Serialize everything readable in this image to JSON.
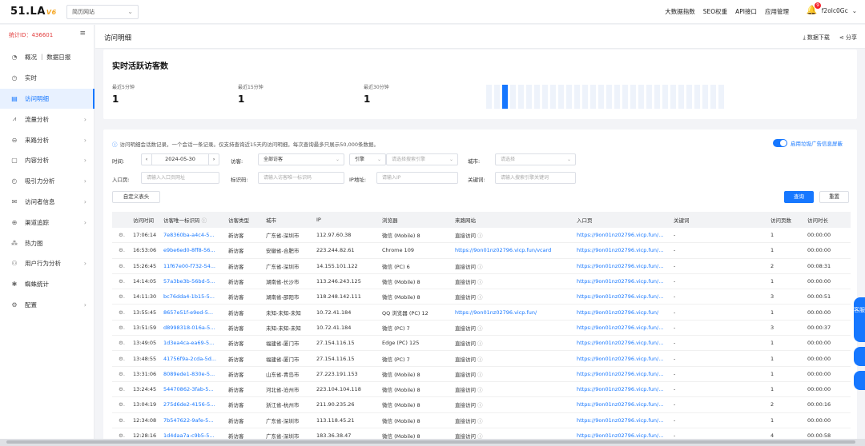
{
  "topbar": {
    "logo": "51.LA",
    "logo_version": "V6",
    "site": "简历网站",
    "nav": [
      "大数据指数",
      "SEO权重",
      "API接口",
      "应用管理"
    ],
    "notification_count": "9",
    "username": "f2olc0Gc"
  },
  "sidebar": {
    "stat_id": "统计ID：436601",
    "items": [
      {
        "label": "概况 ｜ 数据日报",
        "icon": "dashboard-icon",
        "arrow": false,
        "active": false
      },
      {
        "label": "实时",
        "icon": "clock-icon",
        "arrow": false,
        "active": false
      },
      {
        "label": "访问明细",
        "icon": "list-icon",
        "arrow": false,
        "active": true
      },
      {
        "label": "流量分析",
        "icon": "chart-icon",
        "arrow": true,
        "active": false
      },
      {
        "label": "来路分析",
        "icon": "source-icon",
        "arrow": true,
        "active": false
      },
      {
        "label": "内容分析",
        "icon": "file-icon",
        "arrow": true,
        "active": false
      },
      {
        "label": "吸引力分析",
        "icon": "timer-icon",
        "arrow": true,
        "active": false
      },
      {
        "label": "访问者信息",
        "icon": "mail-icon",
        "arrow": true,
        "active": false
      },
      {
        "label": "渠道追踪",
        "icon": "target-icon",
        "arrow": true,
        "active": false
      },
      {
        "label": "热力图",
        "icon": "heatmap-icon",
        "arrow": false,
        "active": false
      },
      {
        "label": "用户行为分析",
        "icon": "users-icon",
        "arrow": true,
        "active": false
      },
      {
        "label": "蜘蛛统计",
        "icon": "spider-icon",
        "arrow": false,
        "active": false
      },
      {
        "label": "配置",
        "icon": "gear-icon",
        "arrow": true,
        "active": false
      }
    ]
  },
  "page": {
    "title": "访问明细",
    "download": "数据下载",
    "share": "分享"
  },
  "realtime": {
    "title": "实时活跃访客数",
    "stats": [
      {
        "label": "最近5分钟",
        "value": "1"
      },
      {
        "label": "最近15分钟",
        "value": "1"
      },
      {
        "label": "最近30分钟",
        "value": "1"
      }
    ],
    "bars_total": 30,
    "bars_active_index": 2
  },
  "filters": {
    "note": "访问明细会话数记录，一个会话一条记录。仅支持查询近15天的访问明细，每次查询最多只展示50,000条数据。",
    "toggle_label": "启用垃圾广告信息屏蔽",
    "time_label": "时间:",
    "date": "2024-05-30",
    "visitor_label": "访客:",
    "visitor_value": "全部访客",
    "engine_label": "引擎",
    "engine_placeholder": "请选择搜索引擎",
    "city_label": "城市:",
    "city_placeholder": "请选择",
    "entry_label": "入口页:",
    "entry_placeholder": "请输入入口页网址",
    "vid_label": "标识码:",
    "vid_placeholder": "请输入访客唯一标识码",
    "ip_label": "IP地址:",
    "ip_placeholder": "请输入IP",
    "kw_label": "关键词:",
    "kw_placeholder": "请输入搜索引擎关键词",
    "custom_header": "自定义表头",
    "query": "查询",
    "reset": "重置"
  },
  "table": {
    "headers": [
      "访问时间",
      "访客唯一标识码",
      "访客类型",
      "城市",
      "IP",
      "浏览器",
      "来路网站",
      "入口页",
      "关键词",
      "访问页数",
      "访问时长"
    ],
    "rows": [
      {
        "time": "17:06:14",
        "vid": "7e8360ba-a4c4-5...",
        "type": "新访客",
        "city": "广东省-深圳市",
        "ip": "112.97.60.38",
        "browser": "微信 (Mobile) 8",
        "source": "直接访问",
        "source_link": false,
        "entry": "https://9on01nz02796.vicp.fun/...",
        "kw": "-",
        "pages": "1",
        "dur": "00:00:00"
      },
      {
        "time": "16:53:06",
        "vid": "e9be6ed0-8ff8-56...",
        "type": "新访客",
        "city": "安徽省-合肥市",
        "ip": "223.244.82.61",
        "browser": "Chrome 109",
        "source": "https://9on01nz02796.vicp.fun/vcard",
        "source_link": true,
        "entry": "https://9on01nz02796.vicp.fun/...",
        "kw": "-",
        "pages": "1",
        "dur": "00:00:00"
      },
      {
        "time": "15:26:45",
        "vid": "11f67e00-f732-54...",
        "type": "新访客",
        "city": "广东省-深圳市",
        "ip": "14.155.101.122",
        "browser": "微信 (PC) 6",
        "source": "直接访问",
        "source_link": false,
        "entry": "https://9on01nz02796.vicp.fun/...",
        "kw": "-",
        "pages": "2",
        "dur": "00:08:31"
      },
      {
        "time": "14:14:05",
        "vid": "57a3be3b-56bd-5...",
        "type": "新访客",
        "city": "湖南省-长沙市",
        "ip": "113.246.243.125",
        "browser": "微信 (Mobile) 8",
        "source": "直接访问",
        "source_link": false,
        "entry": "https://9on01nz02796.vicp.fun/...",
        "kw": "-",
        "pages": "1",
        "dur": "00:00:00"
      },
      {
        "time": "14:11:30",
        "vid": "bc76dda4-1b15-5...",
        "type": "新访客",
        "city": "湖南省-邵阳市",
        "ip": "118.248.142.111",
        "browser": "微信 (Mobile) 8",
        "source": "直接访问",
        "source_link": false,
        "entry": "https://9on01nz02796.vicp.fun/...",
        "kw": "-",
        "pages": "3",
        "dur": "00:00:51"
      },
      {
        "time": "13:55:45",
        "vid": "8657e51f-e9ed-5...",
        "type": "新访客",
        "city": "未知-未知-未知",
        "ip": "10.72.41.184",
        "browser": "QQ 浏览器 (PC) 12",
        "source": "https://9on01nz02796.vicp.fun/",
        "source_link": true,
        "entry": "https://9on01nz02796.vicp.fun/",
        "kw": "-",
        "pages": "1",
        "dur": "00:00:00"
      },
      {
        "time": "13:51:59",
        "vid": "d8998318-016a-5...",
        "type": "新访客",
        "city": "未知-未知-未知",
        "ip": "10.72.41.184",
        "browser": "微信 (PC) 7",
        "source": "直接访问",
        "source_link": false,
        "entry": "https://9on01nz02796.vicp.fun/...",
        "kw": "-",
        "pages": "3",
        "dur": "00:00:37"
      },
      {
        "time": "13:49:05",
        "vid": "1d3ea4ca-ea69-5...",
        "type": "新访客",
        "city": "福建省-厦门市",
        "ip": "27.154.116.15",
        "browser": "Edge (PC) 125",
        "source": "直接访问",
        "source_link": false,
        "entry": "https://9on01nz02796.vicp.fun/...",
        "kw": "-",
        "pages": "1",
        "dur": "00:00:00"
      },
      {
        "time": "13:48:55",
        "vid": "41756f9a-2cda-5d...",
        "type": "新访客",
        "city": "福建省-厦门市",
        "ip": "27.154.116.15",
        "browser": "微信 (PC) 7",
        "source": "直接访问",
        "source_link": false,
        "entry": "https://9on01nz02796.vicp.fun/...",
        "kw": "-",
        "pages": "1",
        "dur": "00:00:00"
      },
      {
        "time": "13:31:06",
        "vid": "8089ede1-830e-5...",
        "type": "新访客",
        "city": "山东省-青岛市",
        "ip": "27.223.191.153",
        "browser": "微信 (Mobile) 8",
        "source": "直接访问",
        "source_link": false,
        "entry": "https://9on01nz02796.vicp.fun/...",
        "kw": "-",
        "pages": "1",
        "dur": "00:00:00"
      },
      {
        "time": "13:24:45",
        "vid": "54470862-3fab-5...",
        "type": "新访客",
        "city": "河北省-沧州市",
        "ip": "223.104.104.118",
        "browser": "微信 (Mobile) 8",
        "source": "直接访问",
        "source_link": false,
        "entry": "https://9on01nz02796.vicp.fun/...",
        "kw": "-",
        "pages": "1",
        "dur": "00:00:00"
      },
      {
        "time": "13:04:19",
        "vid": "275d6de2-4156-5...",
        "type": "新访客",
        "city": "浙江省-杭州市",
        "ip": "211.90.235.26",
        "browser": "微信 (Mobile) 8",
        "source": "直接访问",
        "source_link": false,
        "entry": "https://9on01nz02796.vicp.fun/...",
        "kw": "-",
        "pages": "2",
        "dur": "00:00:16"
      },
      {
        "time": "12:34:08",
        "vid": "7b547622-9afe-5...",
        "type": "新访客",
        "city": "广东省-深圳市",
        "ip": "113.118.45.21",
        "browser": "微信 (Mobile) 8",
        "source": "直接访问",
        "source_link": false,
        "entry": "https://9on01nz02796.vicp.fun/...",
        "kw": "-",
        "pages": "1",
        "dur": "00:00:00"
      },
      {
        "time": "12:28:16",
        "vid": "1d4daa7a-c9b5-5...",
        "type": "新访客",
        "city": "广东省-深圳市",
        "ip": "183.36.38.47",
        "browser": "微信 (Mobile) 8",
        "source": "直接访问",
        "source_link": false,
        "entry": "https://9on01nz02796.vicp.fun/...",
        "kw": "-",
        "pages": "4",
        "dur": "00:00:58"
      }
    ]
  },
  "float_tools": [
    "客服",
    "",
    ""
  ],
  "colors": {
    "accent": "#1677ff",
    "danger": "#f5222d",
    "id_text": "#e23c3c"
  }
}
